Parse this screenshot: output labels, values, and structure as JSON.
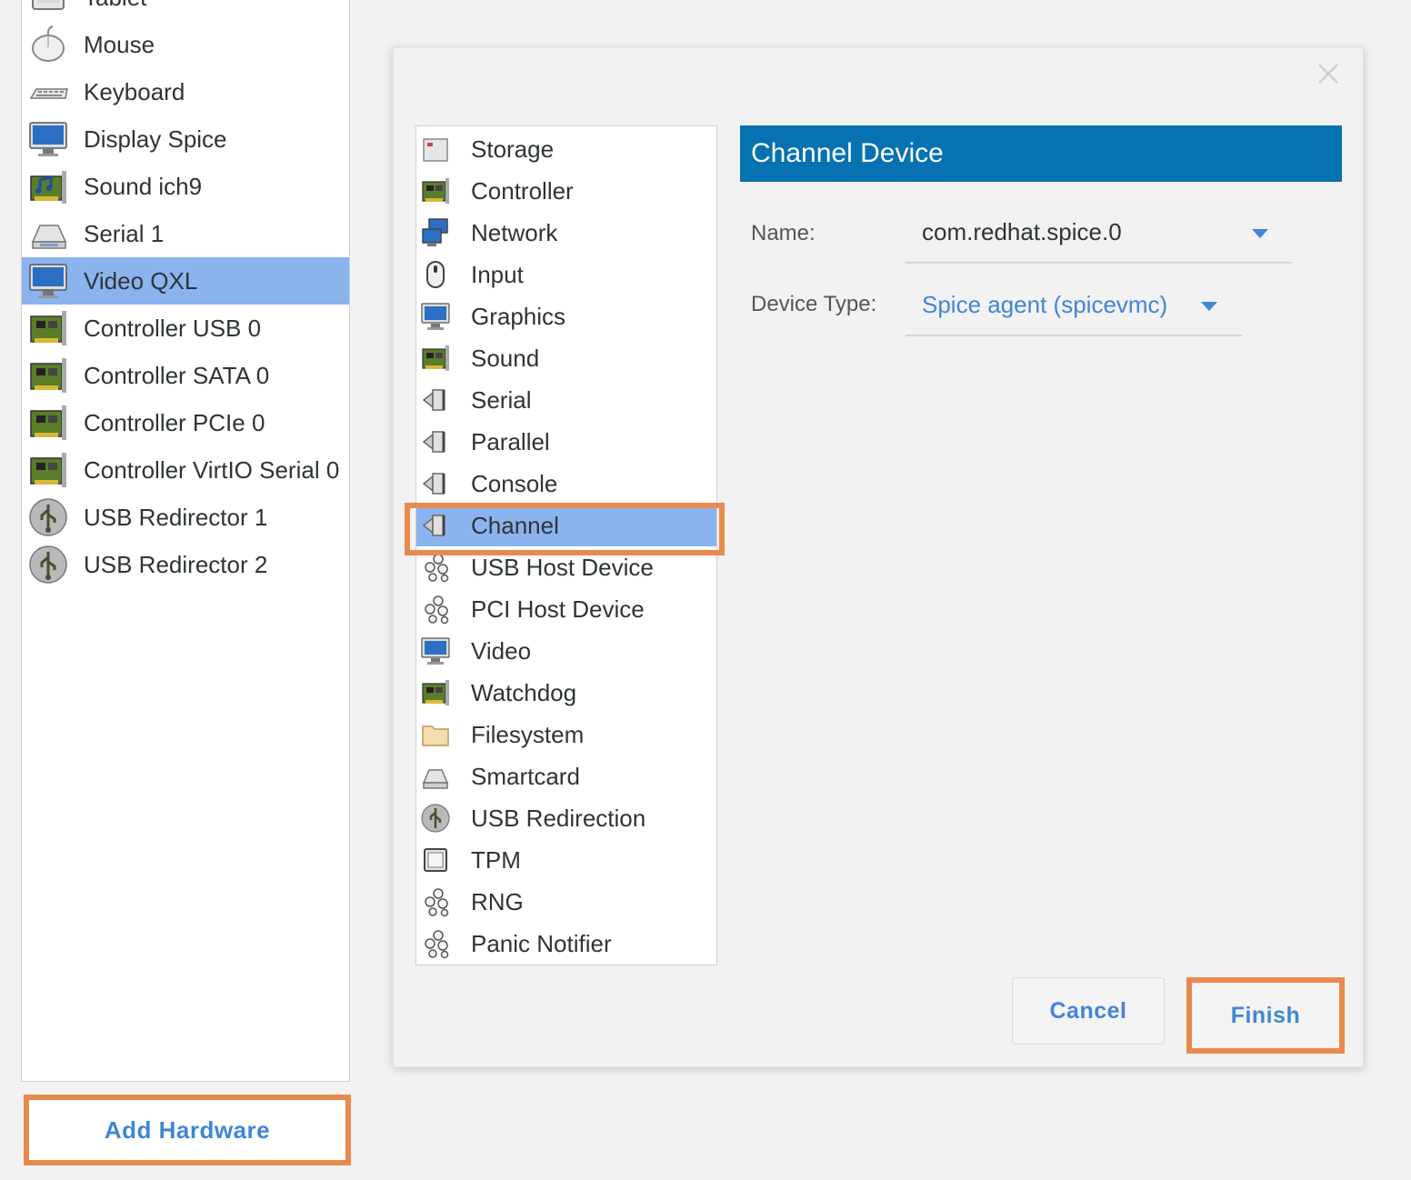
{
  "hardware_list": {
    "items": [
      {
        "label": "Tablet",
        "icon": "tablet-icon"
      },
      {
        "label": "Mouse",
        "icon": "mouse-icon"
      },
      {
        "label": "Keyboard",
        "icon": "keyboard-icon"
      },
      {
        "label": "Display Spice",
        "icon": "display-icon"
      },
      {
        "label": "Sound ich9",
        "icon": "sound-card-icon"
      },
      {
        "label": "Serial 1",
        "icon": "serial-icon"
      },
      {
        "label": "Video QXL",
        "icon": "monitor-icon",
        "selected": true
      },
      {
        "label": "Controller USB 0",
        "icon": "controller-card-icon"
      },
      {
        "label": "Controller SATA 0",
        "icon": "controller-card-icon"
      },
      {
        "label": "Controller PCIe 0",
        "icon": "controller-card-icon"
      },
      {
        "label": "Controller VirtIO Serial 0",
        "icon": "controller-card-icon"
      },
      {
        "label": "USB Redirector 1",
        "icon": "usb-icon"
      },
      {
        "label": "USB Redirector 2",
        "icon": "usb-icon"
      }
    ],
    "add_button_label": "Add Hardware"
  },
  "dialog": {
    "categories": [
      {
        "label": "Storage",
        "icon": "storage-icon"
      },
      {
        "label": "Controller",
        "icon": "controller-card-icon"
      },
      {
        "label": "Network",
        "icon": "network-icon"
      },
      {
        "label": "Input",
        "icon": "mouse-icon"
      },
      {
        "label": "Graphics",
        "icon": "monitor-icon"
      },
      {
        "label": "Sound",
        "icon": "sound-card-icon"
      },
      {
        "label": "Serial",
        "icon": "serial-port-icon"
      },
      {
        "label": "Parallel",
        "icon": "parallel-port-icon"
      },
      {
        "label": "Console",
        "icon": "console-port-icon"
      },
      {
        "label": "Channel",
        "icon": "channel-port-icon",
        "selected": true
      },
      {
        "label": "USB Host Device",
        "icon": "usb-host-icon"
      },
      {
        "label": "PCI Host Device",
        "icon": "pci-host-icon"
      },
      {
        "label": "Video",
        "icon": "monitor-icon"
      },
      {
        "label": "Watchdog",
        "icon": "watchdog-card-icon"
      },
      {
        "label": "Filesystem",
        "icon": "folder-icon"
      },
      {
        "label": "Smartcard",
        "icon": "smartcard-icon"
      },
      {
        "label": "USB Redirection",
        "icon": "usb-icon"
      },
      {
        "label": "TPM",
        "icon": "chip-icon"
      },
      {
        "label": "RNG",
        "icon": "rng-icon"
      },
      {
        "label": "Panic Notifier",
        "icon": "panic-notifier-icon"
      }
    ],
    "detail": {
      "title": "Channel Device",
      "name_label": "Name:",
      "name_value": "com.redhat.spice.0",
      "device_type_label": "Device Type:",
      "device_type_value": "Spice agent (spicevmc)"
    },
    "buttons": {
      "cancel": "Cancel",
      "finish": "Finish"
    }
  },
  "colors": {
    "selection": "#8bb3ee",
    "header": "#0672b2",
    "link": "#3f86d8",
    "highlight": "#e88a4e"
  }
}
